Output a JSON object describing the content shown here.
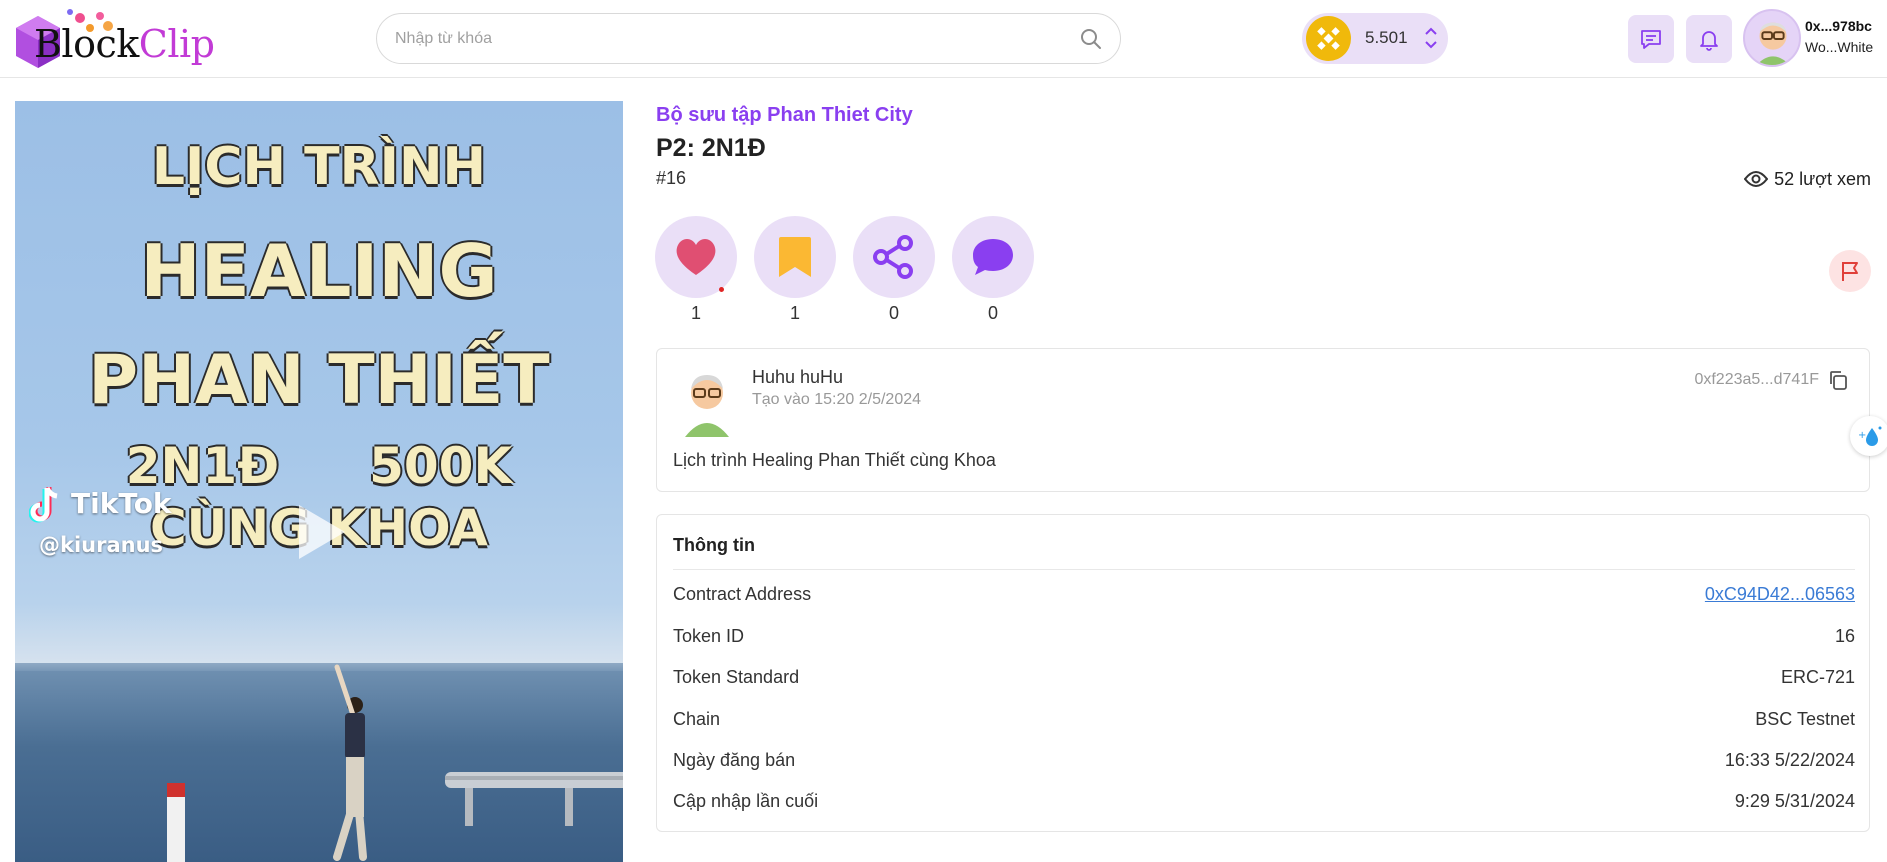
{
  "header": {
    "logo": {
      "part1": "Blo",
      "part2": "ck",
      "part3": "Clip"
    },
    "search": {
      "placeholder": "Nhập từ khóa",
      "value": ""
    },
    "balance": {
      "value": "5.501",
      "coin_icon": "bnb-icon"
    },
    "user": {
      "address": "0x...978bc",
      "name": "Wo...White"
    }
  },
  "media": {
    "overlay_lines": [
      "LỊCH TRÌNH",
      "HEALING",
      "PHAN THIẾT"
    ],
    "overlay_duration": "2N1Đ",
    "overlay_price": "500K",
    "overlay_last": "CÙNG KHOA",
    "watermark": "TikTok",
    "watermark_user": "@kiuranus"
  },
  "detail": {
    "collection": "Bộ sưu tập Phan Thiet City",
    "title": "P2: 2N1Đ",
    "number": "#16",
    "views": "52 lượt xem",
    "actions": {
      "like": "1",
      "save": "1",
      "share": "0",
      "comment": "0"
    }
  },
  "post": {
    "author": "Huhu huHu",
    "created": "Tạo vào 15:20 2/5/2024",
    "wallet": "0xf223a5...d741F",
    "description": "Lịch trình Healing Phan Thiết cùng Khoa"
  },
  "info": {
    "title": "Thông tin",
    "rows": [
      {
        "label": "Contract Address",
        "value": "0xC94D42...06563"
      },
      {
        "label": "Token ID",
        "value": "16"
      },
      {
        "label": "Token Standard",
        "value": "ERC-721"
      },
      {
        "label": "Chain",
        "value": "BSC Testnet"
      },
      {
        "label": "Ngày đăng bán",
        "value": "16:33 5/22/2024"
      },
      {
        "label": "Cập nhập lần cuối",
        "value": "9:29 5/31/2024"
      }
    ]
  },
  "colors": {
    "accent": "#8a3ff0",
    "accent_light": "#eadff7",
    "like": "#e04f72",
    "save": "#fbb833",
    "link": "#3a7bd5",
    "bnb": "#f0b90b"
  }
}
